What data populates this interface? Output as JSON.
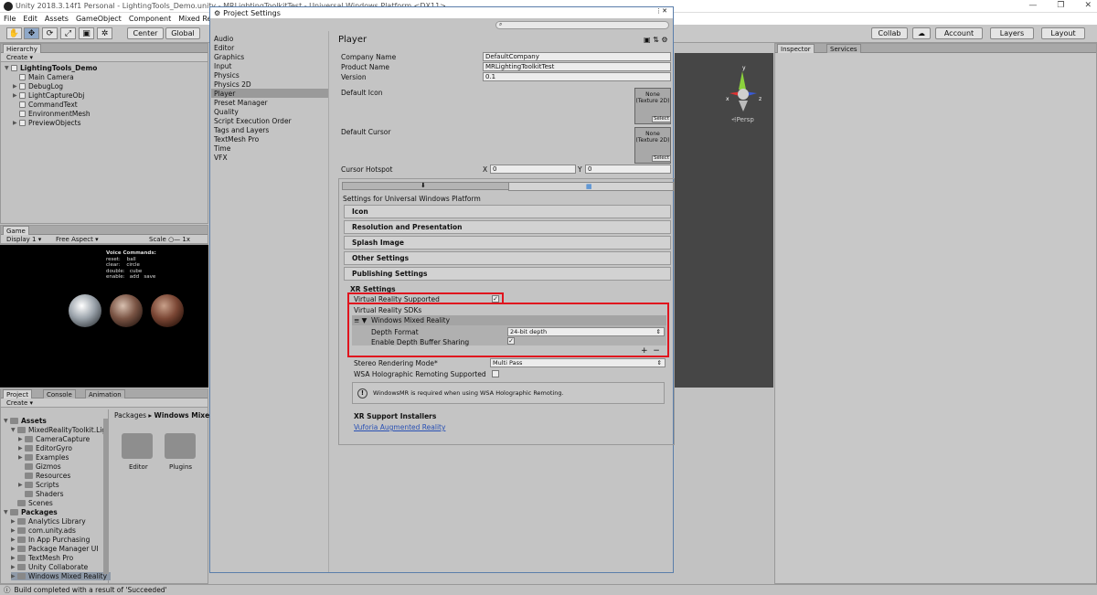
{
  "window": {
    "title": "Unity 2018.3.14f1 Personal - LightingTools_Demo.unity - MRLightingToolkitTest - Universal Windows Platform <DX11>"
  },
  "menu": [
    "File",
    "Edit",
    "Assets",
    "GameObject",
    "Component",
    "Mixed Reality Too"
  ],
  "toolbar": {
    "center": "Center",
    "global": "Global",
    "collab": "Collab",
    "account": "Account",
    "layers": "Layers",
    "layout": "Layout"
  },
  "hierarchy": {
    "tab": "Hierarchy",
    "create": "Create",
    "scene": "LightingTools_Demo",
    "items": [
      "Main Camera",
      "DebugLog",
      "LightCaptureObj",
      "CommandText",
      "EnvironmentMesh",
      "PreviewObjects"
    ]
  },
  "game": {
    "tab": "Game",
    "display": "Display 1",
    "aspect": "Free Aspect",
    "scale_label": "Scale",
    "scale_value": "1x",
    "commands_title": "Voice Commands:",
    "commands": "reset:    ball\nclear:    circle\ndouble:   cube\nenable:   add   save"
  },
  "project": {
    "tab": "Project",
    "console_tab": "Console",
    "animation_tab": "Animation",
    "create": "Create",
    "breadcrumb": [
      "Packages",
      "Windows Mixed"
    ],
    "assets_root": "Assets",
    "assets": [
      "MixedRealityToolkit.Lig",
      "CameraCapture",
      "EditorGyro",
      "Examples",
      "Gizmos",
      "Resources",
      "Scripts",
      "Shaders",
      "Scenes"
    ],
    "packages_root": "Packages",
    "packages": [
      "Analytics Library",
      "com.unity.ads",
      "In App Purchasing",
      "Package Manager UI",
      "TextMesh Pro",
      "Unity Collaborate",
      "Windows Mixed Reality"
    ],
    "folders": [
      "Editor",
      "Plugins"
    ]
  },
  "settings": {
    "title": "Project Settings",
    "categories": [
      "Audio",
      "Editor",
      "Graphics",
      "Input",
      "Physics",
      "Physics 2D",
      "Player",
      "Preset Manager",
      "Quality",
      "Script Execution Order",
      "Tags and Layers",
      "TextMesh Pro",
      "Time",
      "VFX"
    ],
    "heading": "Player",
    "company_label": "Company Name",
    "company_value": "DefaultCompany",
    "product_label": "Product Name",
    "product_value": "MRLightingToolkitTest",
    "version_label": "Version",
    "version_value": "0.1",
    "icon_label": "Default Icon",
    "cursor_label": "Default Cursor",
    "texture_text": "None (Texture 2D)",
    "select": "Select",
    "hotspot_label": "Cursor Hotspot",
    "hotspot_x_label": "X",
    "hotspot_x": "0",
    "hotspot_y_label": "Y",
    "hotspot_y": "0",
    "platform_label": "Settings for Universal Windows Platform",
    "sections": [
      "Icon",
      "Resolution and Presentation",
      "Splash Image",
      "Other Settings",
      "Publishing Settings"
    ],
    "xr_heading": "XR Settings",
    "vr_supported": "Virtual Reality Supported",
    "vr_sdks": "Virtual Reality SDKs",
    "wmr": "Windows Mixed Reality",
    "depth_format_label": "Depth Format",
    "depth_format_value": "24-bit depth",
    "depth_sharing_label": "Enable Depth Buffer Sharing",
    "stereo_label": "Stereo Rendering Mode*",
    "stereo_value": "Multi Pass",
    "remoting_label": "WSA Holographic Remoting Supported",
    "info_text": "WindowsMR is required when using WSA Holographic Remoting.",
    "installers_heading": "XR Support Installers",
    "vuforia_link": "Vuforia Augmented Reality"
  },
  "inspector": {
    "tab": "Inspector",
    "services_tab": "Services"
  },
  "scene_view": {
    "persp": "Persp"
  },
  "status": "Build completed with a result of 'Succeeded'",
  "colors": {
    "highlight": "#e0141e",
    "link": "#2850b4",
    "window_border": "#5a7eaa"
  }
}
